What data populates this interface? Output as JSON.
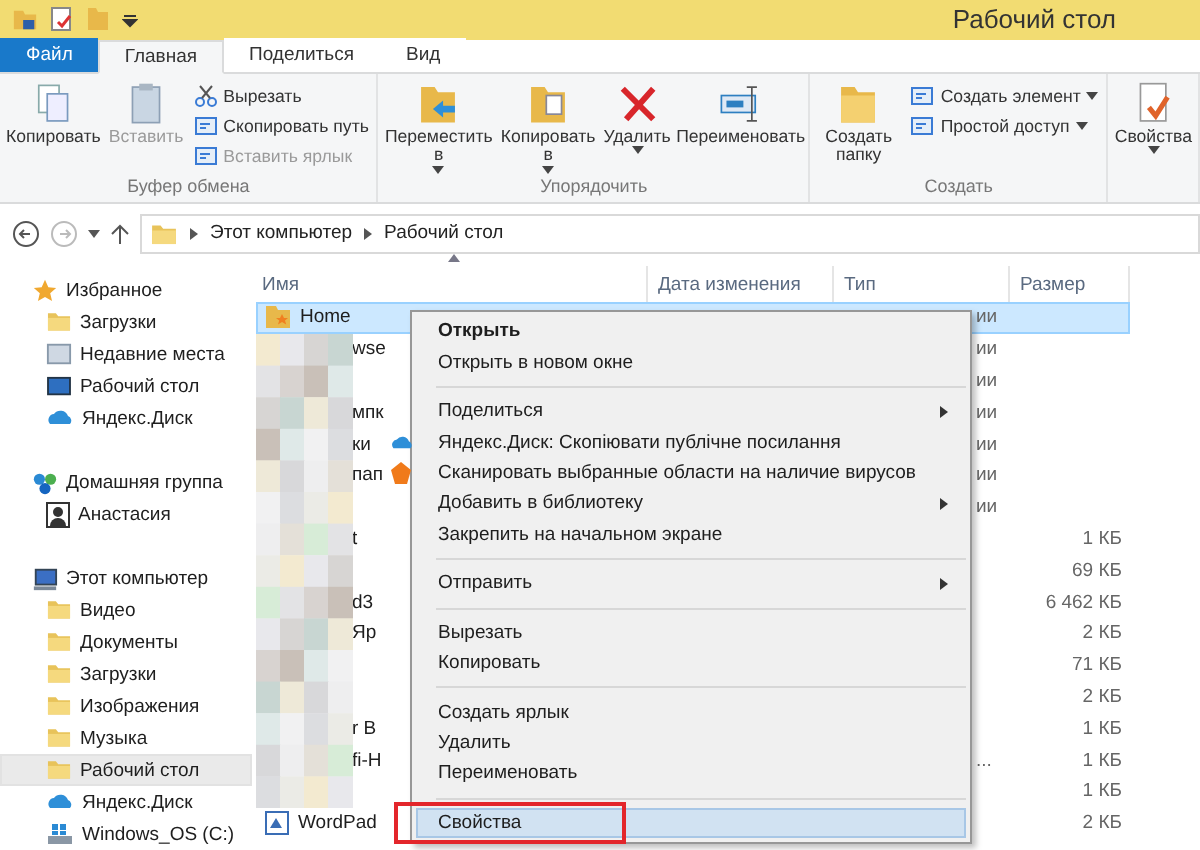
{
  "window": {
    "title": "Рабочий стол"
  },
  "tabs": [
    {
      "label": "Файл",
      "kind": "file",
      "selected": false
    },
    {
      "label": "Главная",
      "kind": "tab",
      "selected": true
    },
    {
      "label": "Поделиться",
      "kind": "tab",
      "selected": false
    },
    {
      "label": "Вид",
      "kind": "tab",
      "selected": false
    }
  ],
  "ribbon": {
    "groups": [
      {
        "label": "Буфер обмена",
        "large": [
          {
            "label": "Копировать",
            "disabled": false
          },
          {
            "label": "Вставить",
            "disabled": true
          }
        ],
        "small": [
          {
            "label": "Вырезать",
            "disabled": false,
            "dropdown": false
          },
          {
            "label": "Скопировать путь",
            "disabled": false,
            "dropdown": false
          },
          {
            "label": "Вставить ярлык",
            "disabled": true,
            "dropdown": false
          }
        ]
      },
      {
        "label": "Упорядочить",
        "large": [
          {
            "label": "Переместить в",
            "disabled": false,
            "dropdown": true
          },
          {
            "label": "Копировать в",
            "disabled": false,
            "dropdown": true
          },
          {
            "label": "Удалить",
            "disabled": false,
            "dropdown": true
          },
          {
            "label": "Переименовать",
            "disabled": false
          }
        ]
      },
      {
        "label": "Создать",
        "large": [
          {
            "label": "Создать папку",
            "disabled": false
          }
        ],
        "small": [
          {
            "label": "Создать элемент",
            "disabled": false,
            "dropdown": true
          },
          {
            "label": "Простой доступ",
            "disabled": false,
            "dropdown": true
          }
        ]
      },
      {
        "large": [
          {
            "label": "Свойства",
            "disabled": false,
            "dropdown": true
          }
        ]
      }
    ]
  },
  "address": {
    "path": [
      "Этот компьютер",
      "Рабочий стол"
    ]
  },
  "sidebar": {
    "groups": [
      {
        "label": "Избранное",
        "children": [
          {
            "label": "Загрузки",
            "selected": false
          },
          {
            "label": "Недавние места",
            "selected": false
          },
          {
            "label": "Рабочий стол",
            "selected": false
          },
          {
            "label": "Яндекс.Диск",
            "selected": false
          }
        ]
      },
      {
        "label": "Домашняя группа",
        "children": [
          {
            "label": "Анастасия",
            "selected": false
          }
        ]
      },
      {
        "label": "Этот компьютер",
        "children": [
          {
            "label": "Видео",
            "selected": false
          },
          {
            "label": "Документы",
            "selected": false
          },
          {
            "label": "Загрузки",
            "selected": false
          },
          {
            "label": "Изображения",
            "selected": false
          },
          {
            "label": "Музыка",
            "selected": false
          },
          {
            "label": "Рабочий стол",
            "selected": true
          },
          {
            "label": "Яндекс.Диск",
            "selected": false
          },
          {
            "label": "Windows_OS (C:)",
            "selected": false
          }
        ]
      }
    ]
  },
  "table": {
    "columns": [
      "Имя",
      "Дата изменения",
      "Тип",
      "Размер"
    ],
    "rows": [
      {
        "kind": "folder",
        "name": "Home",
        "type": "ии",
        "selected": true
      },
      {
        "kind": "blurred",
        "name": "wse",
        "type": "ии",
        "selected": false
      },
      {
        "kind": "blurred",
        "type": "ии",
        "selected": false
      },
      {
        "kind": "blurred",
        "name": "мпк",
        "type": "ии",
        "selected": false
      },
      {
        "kind": "blurred",
        "name": "ки",
        "type": "ии",
        "selected": false
      },
      {
        "kind": "blurred",
        "name": "пап",
        "type": "ии",
        "selected": false
      },
      {
        "kind": "blurred",
        "type": "ии",
        "selected": false
      },
      {
        "kind": "blurred",
        "name": "t",
        "size": "1 КБ",
        "selected": false
      },
      {
        "kind": "blurred",
        "size": "69 КБ",
        "selected": false
      },
      {
        "kind": "blurred",
        "name": "d3",
        "size": "6 462 КБ",
        "selected": false
      },
      {
        "kind": "blurred",
        "name": "Яр",
        "size": "2 КБ",
        "selected": false
      },
      {
        "kind": "blurred",
        "size": "71 КБ",
        "selected": false
      },
      {
        "kind": "blurred",
        "size": "2 КБ",
        "selected": false
      },
      {
        "kind": "blurred",
        "name": "r B",
        "size": "1 КБ",
        "selected": false
      },
      {
        "kind": "blurred",
        "name": "fi-H",
        "type": "...",
        "size": "1 КБ",
        "selected": false
      },
      {
        "kind": "blurred",
        "size": "1 КБ",
        "selected": false
      },
      {
        "kind": "app",
        "name": "WordPad",
        "size": "2 КБ",
        "selected": false
      }
    ]
  },
  "context_menu": {
    "items": [
      {
        "kind": "item",
        "label": "Открыть",
        "default": true,
        "submenu": false,
        "selected": false
      },
      {
        "kind": "item",
        "label": "Открыть в новом окне",
        "default": false,
        "submenu": false,
        "selected": false
      },
      {
        "kind": "separator"
      },
      {
        "kind": "item",
        "label": "Поделиться",
        "default": false,
        "submenu": true,
        "selected": false
      },
      {
        "kind": "item",
        "label": "Яндекс.Диск: Скопіювати публічне посилання",
        "default": false,
        "submenu": false,
        "selected": false
      },
      {
        "kind": "item",
        "label": "Сканировать выбранные области на наличие вирусов",
        "default": false,
        "submenu": false,
        "selected": false
      },
      {
        "kind": "item",
        "label": "Добавить в библиотеку",
        "default": false,
        "submenu": true,
        "selected": false
      },
      {
        "kind": "item",
        "label": "Закрепить на начальном экране",
        "default": false,
        "submenu": false,
        "selected": false
      },
      {
        "kind": "separator"
      },
      {
        "kind": "item",
        "label": "Отправить",
        "default": false,
        "submenu": true,
        "selected": false
      },
      {
        "kind": "separator"
      },
      {
        "kind": "item",
        "label": "Вырезать",
        "default": false,
        "submenu": false,
        "selected": false
      },
      {
        "kind": "item",
        "label": "Копировать",
        "default": false,
        "submenu": false,
        "selected": false
      },
      {
        "kind": "separator"
      },
      {
        "kind": "item",
        "label": "Создать ярлык",
        "default": false,
        "submenu": false,
        "selected": false
      },
      {
        "kind": "item",
        "label": "Удалить",
        "default": false,
        "submenu": false,
        "selected": false
      },
      {
        "kind": "item",
        "label": "Переименовать",
        "default": false,
        "submenu": false,
        "selected": false
      },
      {
        "kind": "separator"
      },
      {
        "kind": "item",
        "label": "Свойства",
        "default": false,
        "submenu": false,
        "selected": true,
        "highlighted": true
      }
    ]
  }
}
